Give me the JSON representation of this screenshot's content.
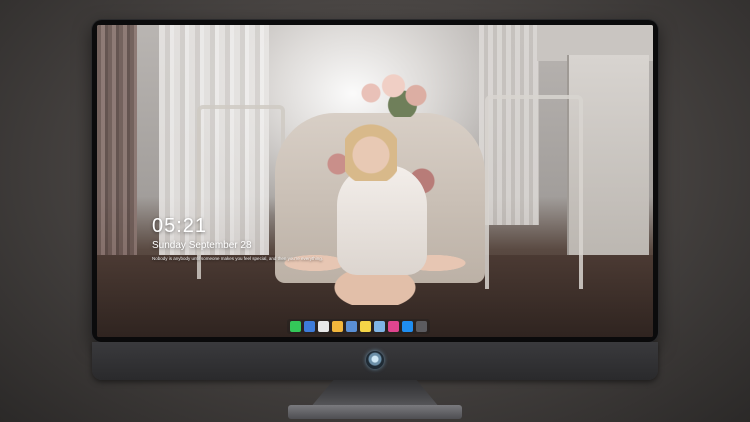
{
  "lockscreen": {
    "time": "05:21",
    "date": "Sunday September  28",
    "quote": "Nobody is anybody until someone makes you feel special, and then you're everything."
  },
  "dock": {
    "apps": [
      {
        "name": "messages-icon",
        "color": "#34c759"
      },
      {
        "name": "finder-icon",
        "color": "#3d7bd9"
      },
      {
        "name": "safari-icon",
        "color": "#e8e8e8"
      },
      {
        "name": "photos-icon",
        "color": "#f2b63c"
      },
      {
        "name": "clapper-icon",
        "color": "#5a8fd6"
      },
      {
        "name": "notes-icon",
        "color": "#f5d547"
      },
      {
        "name": "preview-icon",
        "color": "#7fb5e6"
      },
      {
        "name": "music-icon",
        "color": "#e0458e"
      },
      {
        "name": "app-store-icon",
        "color": "#1f8ef1"
      },
      {
        "name": "camera-icon",
        "color": "#5b5b5f"
      }
    ]
  }
}
